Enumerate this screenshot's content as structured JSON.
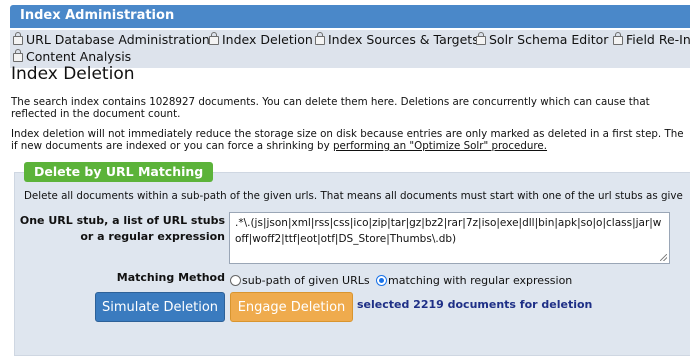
{
  "header": {
    "title": "Index Administration"
  },
  "tabs": [
    {
      "label": "URL Database Administration"
    },
    {
      "label": "Index Deletion"
    },
    {
      "label": "Index Sources & Targets"
    },
    {
      "label": "Solr Schema Editor"
    },
    {
      "label": "Field Re-Ind"
    },
    {
      "label": "Content Analysis"
    }
  ],
  "page": {
    "title": "Index Deletion",
    "intro_line1": "The search index contains 1028927 documents. You can delete them here. Deletions are concurrently which can cause that",
    "intro_line2": "reflected in the document count.",
    "note_line1": "Index deletion will not immediately reduce the storage size on disk because entries are only marked as deleted in a first step. The",
    "note_line2_prefix": "if new documents are indexed or you can force a shrinking by ",
    "note_link": "performing an \"Optimize Solr\" procedure."
  },
  "panel": {
    "title": "Delete by URL Matching",
    "description": "Delete all documents within a sub-path of the given urls. That means all documents must start with one of the url stubs as give",
    "url_label_line1": "One URL stub, a list of URL stubs",
    "url_label_line2": "or a regular expression",
    "url_value": ".*\\.(js|json|xml|rss|css|ico|zip|tar|gz|bz2|rar|7z|iso|exe|dll|bin|apk|so|o|class|jar|woff|woff2|ttf|eot|otf|DS_Store|Thumbs\\.db)",
    "matching_label": "Matching Method",
    "option_subpath": "sub-path of given URLs",
    "option_regex": "matching with regular expression",
    "selected_option": "regex",
    "simulate_button": "Simulate Deletion",
    "engage_button": "Engage Deletion",
    "status": "selected 2219 documents for deletion"
  }
}
